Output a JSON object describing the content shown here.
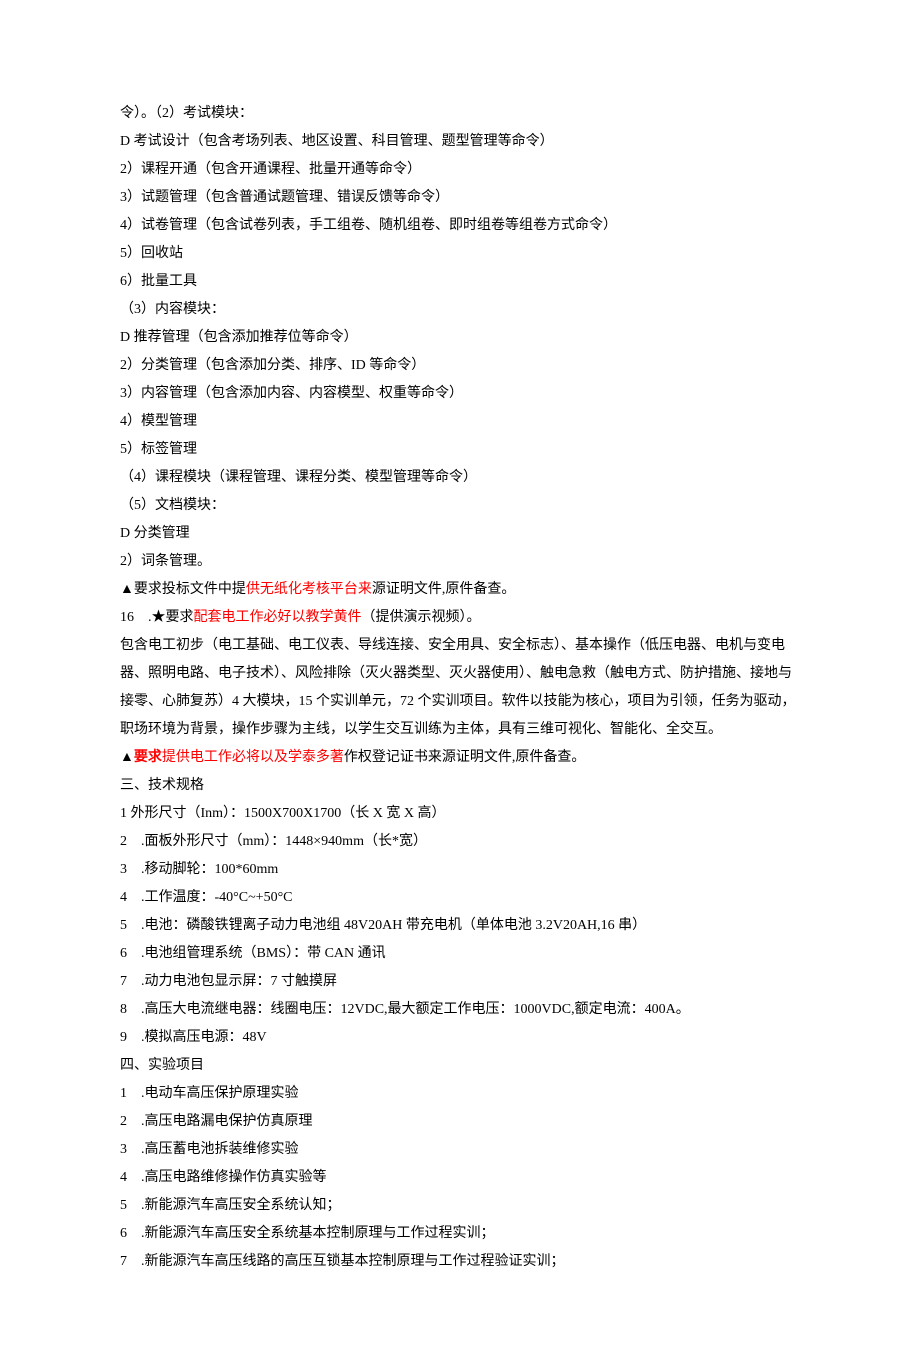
{
  "lines": [
    {
      "parts": [
        {
          "t": "令）。（2）考试模块："
        }
      ]
    },
    {
      "parts": [
        {
          "t": "D 考试设计（包含考场列表、地区设置、科目管理、题型管理等命令）"
        }
      ]
    },
    {
      "parts": [
        {
          "t": "2）课程开通（包含开通课程、批量开通等命令）"
        }
      ]
    },
    {
      "parts": [
        {
          "t": "3）试题管理（包含普通试题管理、错误反馈等命令）"
        }
      ]
    },
    {
      "parts": [
        {
          "t": "4）试卷管理（包含试卷列表，手工组卷、随机组卷、即时组卷等组卷方式命令）"
        }
      ]
    },
    {
      "parts": [
        {
          "t": "5）回收站"
        }
      ]
    },
    {
      "parts": [
        {
          "t": "6）批量工具"
        }
      ]
    },
    {
      "parts": [
        {
          "t": "（3）内容模块："
        }
      ]
    },
    {
      "parts": [
        {
          "t": "D 推荐管理（包含添加推荐位等命令）"
        }
      ]
    },
    {
      "parts": [
        {
          "t": "2）分类管理（包含添加分类、排序、ID 等命令）"
        }
      ]
    },
    {
      "parts": [
        {
          "t": "3）内容管理（包含添加内容、内容模型、权重等命令）"
        }
      ]
    },
    {
      "parts": [
        {
          "t": "4）模型管理"
        }
      ]
    },
    {
      "parts": [
        {
          "t": "5）标签管理"
        }
      ]
    },
    {
      "parts": [
        {
          "t": "（4）课程模块（课程管理、课程分类、模型管理等命令）"
        }
      ]
    },
    {
      "parts": [
        {
          "t": "（5）文档模块："
        }
      ]
    },
    {
      "parts": [
        {
          "t": "D 分类管理"
        }
      ]
    },
    {
      "parts": [
        {
          "t": "2）词条管理。"
        }
      ]
    },
    {
      "parts": [
        {
          "t": "▲要求投标文件中提"
        },
        {
          "t": "供无纸化考核",
          "red": true
        },
        {
          "t": "平台来",
          "red": true
        },
        {
          "t": "源证明文件,原件备查。"
        }
      ]
    },
    {
      "parts": [
        {
          "t": "16　.★要求"
        },
        {
          "t": "配套电工作必好以教学黄件",
          "red": true
        },
        {
          "t": "（提供演示视频）。"
        }
      ]
    },
    {
      "parts": [
        {
          "t": "包含电工初步（电工基础、电工仪表、导线连接、安全用具、安全标志）、基本操作（低压电器、电机与变电器、照明电路、电子技术）、风险排除（灭火器类型、灭火器使用）、触电急救（触电方式、防护措施、接地与接零、心肺复苏）4 大模块，15 个实训单元，72 个实训项目。软件以技能为核心，项目为引领，任务为驱动，职场环境为背景，操作步骤为主线，以学生交互训练为主体，具有三维可视化、智能化、全交互。"
        }
      ]
    },
    {
      "parts": [
        {
          "t": "▲",
          "bold": true
        },
        {
          "t": "要求",
          "bold": true,
          "red": true
        },
        {
          "t": "提供电工作必将以及学泰",
          "red": true
        },
        {
          "t": "多著",
          "red": true
        },
        {
          "t": "作权登记证书来源证明文件,原件备查。"
        }
      ]
    },
    {
      "parts": [
        {
          "t": "三、技术规格"
        }
      ]
    },
    {
      "parts": [
        {
          "t": "1 外形尺寸（Inm）：1500X700X1700（长 X 宽 X 高）"
        }
      ]
    },
    {
      "parts": [
        {
          "t": "2　.面板外形尺寸（mm）：1448×940mm（长*宽）"
        }
      ]
    },
    {
      "parts": [
        {
          "t": "3　.移动脚轮：100*60mm"
        }
      ]
    },
    {
      "parts": [
        {
          "t": "4　.工作温度：-40°C~+50°C"
        }
      ]
    },
    {
      "parts": [
        {
          "t": "5　.电池：磷酸铁锂离子动力电池组 48V20AH 带充电机（单体电池 3.2V20AH,16 串）"
        }
      ]
    },
    {
      "parts": [
        {
          "t": "6　.电池组管理系统（BMS）：带 CAN 通讯"
        }
      ]
    },
    {
      "parts": [
        {
          "t": "7　.动力电池包显示屏：7 寸触摸屏"
        }
      ]
    },
    {
      "parts": [
        {
          "t": "8　.高压大电流继电器：线圈电压：12VDC,最大额定工作电压：1000VDC,额定电流：400A。"
        }
      ]
    },
    {
      "parts": [
        {
          "t": "9　.模拟高压电源：48V"
        }
      ]
    },
    {
      "parts": [
        {
          "t": "四、实验项目"
        }
      ]
    },
    {
      "parts": [
        {
          "t": "1　.电动车高压保护原理实验"
        }
      ]
    },
    {
      "parts": [
        {
          "t": "2　.高压电路漏电保护仿真原理"
        }
      ]
    },
    {
      "parts": [
        {
          "t": "3　.高压蓄电池拆装维修实验"
        }
      ]
    },
    {
      "parts": [
        {
          "t": "4　.高压电路维修操作仿真实验等"
        }
      ]
    },
    {
      "parts": [
        {
          "t": "5　.新能源汽车高压安全系统认知；"
        }
      ]
    },
    {
      "parts": [
        {
          "t": "6　.新能源汽车高压安全系统基本控制原理与工作过程实训；"
        }
      ]
    },
    {
      "parts": [
        {
          "t": "7　.新能源汽车高压线路的高压互锁基本控制原理与工作过程验证实训；"
        }
      ]
    }
  ]
}
